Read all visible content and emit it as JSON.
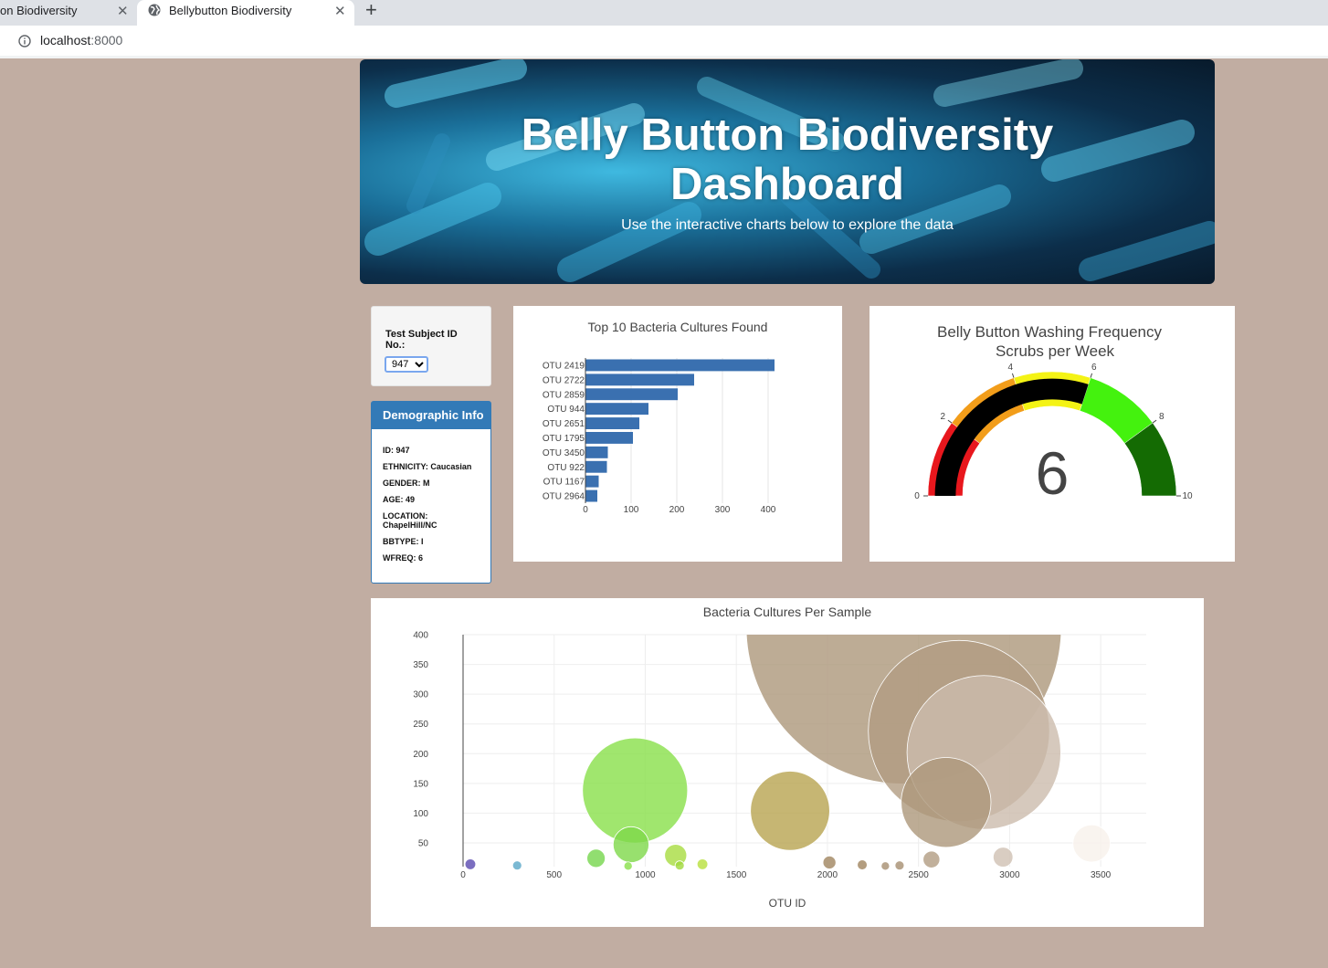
{
  "browser": {
    "tabs": [
      {
        "label": "on Biodiversity",
        "active": false
      },
      {
        "label": "Bellybutton Biodiversity",
        "active": true
      }
    ],
    "close_glyph": "✕",
    "new_tab_glyph": "+",
    "url_host": "localhost",
    "url_port": ":8000"
  },
  "header": {
    "title_line1": "Belly Button Biodiversity",
    "title_line2": "Dashboard",
    "subtitle": "Use the interactive charts below to explore the data"
  },
  "selector": {
    "label": "Test Subject ID No.:",
    "value": "947"
  },
  "demographics": {
    "title": "Demographic Info",
    "rows": [
      "ID: 947",
      "ETHNICITY: Caucasian",
      "GENDER: M",
      "AGE: 49",
      "LOCATION: ChapelHill/NC",
      "BBTYPE: I",
      "WFREQ: 6"
    ]
  },
  "chart_data": [
    {
      "type": "bar",
      "orientation": "horizontal",
      "title": "Top 10 Bacteria Cultures Found",
      "categories": [
        "OTU 2419",
        "OTU 2722",
        "OTU 2859",
        "OTU 944",
        "OTU 2651",
        "OTU 1795",
        "OTU 3450",
        "OTU 922",
        "OTU 1167",
        "OTU 2964"
      ],
      "values": [
        414,
        238,
        202,
        138,
        118,
        104,
        49,
        47,
        29,
        26
      ],
      "xticks": [
        0,
        100,
        200,
        300,
        400
      ],
      "xlim": [
        0,
        420
      ],
      "color": "#3a70b0"
    },
    {
      "type": "gauge",
      "title_line1": "Belly Button Washing Frequency",
      "title_line2": "Scrubs per Week",
      "value": 6,
      "value_label": "6",
      "range": [
        0,
        10
      ],
      "ticks": [
        0,
        2,
        4,
        6,
        8,
        10
      ],
      "steps": [
        {
          "range": [
            0,
            2
          ],
          "color": "#e8171d"
        },
        {
          "range": [
            2,
            4
          ],
          "color": "#f29d1a"
        },
        {
          "range": [
            4,
            6
          ],
          "color": "#f4f315"
        },
        {
          "range": [
            6,
            8
          ],
          "color": "#44f20e"
        },
        {
          "range": [
            8,
            10
          ],
          "color": "#146b03"
        }
      ],
      "bar_color": "#000000"
    },
    {
      "type": "scatter",
      "subtype": "bubble",
      "title": "Bacteria Cultures Per Sample",
      "xlabel": "OTU ID",
      "xticks": [
        0,
        500,
        1000,
        1500,
        2000,
        2500,
        3000,
        3500
      ],
      "yticks": [
        50,
        100,
        150,
        200,
        250,
        300,
        350,
        400
      ],
      "xlim": [
        0,
        3750
      ],
      "ylim": [
        10,
        400
      ],
      "points": [
        {
          "x": 2419,
          "y": 414,
          "color": "#ad977a"
        },
        {
          "x": 2722,
          "y": 238,
          "color": "#b29c82"
        },
        {
          "x": 2859,
          "y": 202,
          "color": "#ccbcad"
        },
        {
          "x": 944,
          "y": 138,
          "color": "#88e04a"
        },
        {
          "x": 1795,
          "y": 104,
          "color": "#b8a450"
        },
        {
          "x": 2651,
          "y": 118,
          "color": "#ad977a"
        },
        {
          "x": 922,
          "y": 47,
          "color": "#7ed84a"
        },
        {
          "x": 1167,
          "y": 29,
          "color": "#a8dc40"
        },
        {
          "x": 730,
          "y": 24,
          "color": "#76d64c"
        },
        {
          "x": 2964,
          "y": 26,
          "color": "#d0c0b3"
        },
        {
          "x": 2571,
          "y": 22,
          "color": "#b29c82"
        },
        {
          "x": 2011,
          "y": 17,
          "color": "#a0855f"
        },
        {
          "x": 40,
          "y": 14,
          "color": "#5a4ab0"
        },
        {
          "x": 2191,
          "y": 13,
          "color": "#a0855f"
        },
        {
          "x": 1314,
          "y": 14,
          "color": "#b8e03c"
        },
        {
          "x": 297,
          "y": 12,
          "color": "#5aa8c8"
        },
        {
          "x": 2396,
          "y": 12,
          "color": "#a68e71"
        },
        {
          "x": 1189,
          "y": 12,
          "color": "#a0d83c"
        },
        {
          "x": 906,
          "y": 11,
          "color": "#88e04a"
        },
        {
          "x": 2318,
          "y": 11,
          "color": "#a68e71"
        },
        {
          "x": 3450,
          "y": 49,
          "color": "#f7f1eb"
        }
      ]
    }
  ]
}
